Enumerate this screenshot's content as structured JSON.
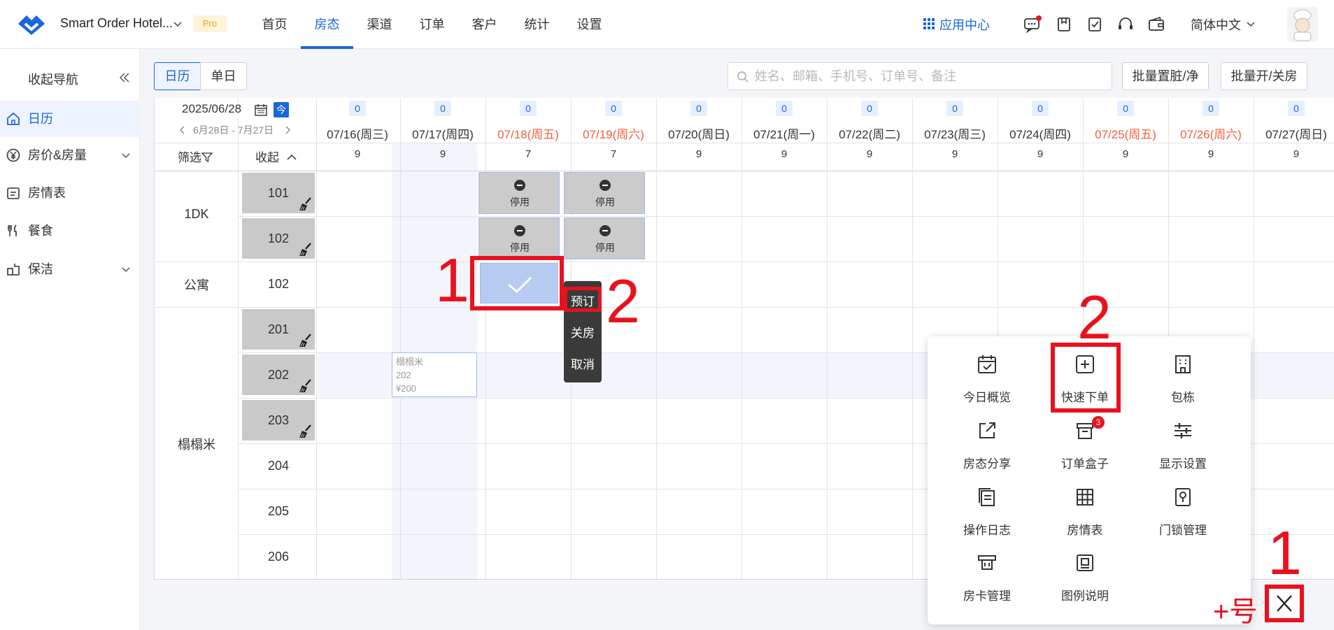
{
  "header": {
    "brand": "Smart Order Hotel...",
    "pro_badge": "Pro",
    "nav": [
      "首页",
      "房态",
      "渠道",
      "订单",
      "客户",
      "统计",
      "设置"
    ],
    "active_nav": "房态",
    "app_center": "应用中心",
    "language": "简体中文",
    "accent_color": "#1a66d9"
  },
  "sidebar": {
    "title": "收起导航",
    "items": [
      {
        "label": "日历",
        "icon": "home-icon",
        "active": true
      },
      {
        "label": "房价&房量",
        "icon": "yen-icon",
        "expandable": true
      },
      {
        "label": "房情表",
        "icon": "clipboard-icon"
      },
      {
        "label": "餐食",
        "icon": "fork-knife-icon"
      },
      {
        "label": "保洁",
        "icon": "cleaning-icon",
        "expandable": true
      }
    ]
  },
  "toolbar": {
    "view_calendar": "日历",
    "view_single": "单日",
    "search_placeholder": "姓名、邮箱、手机号、订单号、备注",
    "btn_dirty_clean": "批量置脏/净",
    "btn_open_close": "批量开/关房"
  },
  "calendar": {
    "current_date": "2025/06/28",
    "today_label": "今",
    "range": "6月28日 - 7月27日",
    "filter_label": "筛选",
    "fold_label": "收起",
    "dates": [
      {
        "label": "07/16(周三)",
        "count": "0",
        "avail": "9",
        "weekend": false
      },
      {
        "label": "07/17(周四)",
        "count": "0",
        "avail": "9",
        "weekend": false
      },
      {
        "label": "07/18(周五)",
        "count": "0",
        "avail": "7",
        "weekend": true
      },
      {
        "label": "07/19(周六)",
        "count": "0",
        "avail": "7",
        "weekend": true
      },
      {
        "label": "07/20(周日)",
        "count": "0",
        "avail": "9",
        "weekend": false
      },
      {
        "label": "07/21(周一)",
        "count": "0",
        "avail": "9",
        "weekend": false
      },
      {
        "label": "07/22(周二)",
        "count": "0",
        "avail": "9",
        "weekend": false
      },
      {
        "label": "07/23(周三)",
        "count": "0",
        "avail": "9",
        "weekend": false
      },
      {
        "label": "07/24(周四)",
        "count": "0",
        "avail": "9",
        "weekend": false
      },
      {
        "label": "07/25(周五)",
        "count": "0",
        "avail": "9",
        "weekend": true
      },
      {
        "label": "07/26(周六)",
        "count": "0",
        "avail": "9",
        "weekend": true
      },
      {
        "label": "07/27(周日)",
        "count": "0",
        "avail": "9",
        "weekend": false
      }
    ],
    "room_types": [
      "1DK",
      "公寓",
      "榻榻米"
    ],
    "rooms": [
      {
        "no": "101",
        "dirty": true
      },
      {
        "no": "102",
        "dirty": true
      },
      {
        "no": "102",
        "dirty": false
      },
      {
        "no": "201",
        "dirty": true
      },
      {
        "no": "202",
        "dirty": true
      },
      {
        "no": "203",
        "dirty": true
      },
      {
        "no": "204",
        "dirty": false
      },
      {
        "no": "205",
        "dirty": false
      },
      {
        "no": "206",
        "dirty": false
      }
    ],
    "disabled_label": "停用",
    "booking": {
      "line1": "榻榻米",
      "line2": "202",
      "line3": "¥200"
    }
  },
  "context_menu": {
    "book": "预订",
    "close": "关房",
    "cancel": "取消"
  },
  "quick_panel": {
    "items": [
      {
        "label": "今日概览",
        "icon": "calendar-check-icon"
      },
      {
        "label": "快速下单",
        "icon": "plus-square-icon"
      },
      {
        "label": "包栋",
        "icon": "building-icon"
      },
      {
        "label": "房态分享",
        "icon": "share-icon"
      },
      {
        "label": "订单盒子",
        "icon": "inbox-icon",
        "badge": "3"
      },
      {
        "label": "显示设置",
        "icon": "sliders-icon"
      },
      {
        "label": "操作日志",
        "icon": "document-icon"
      },
      {
        "label": "房情表",
        "icon": "grid-icon"
      },
      {
        "label": "门锁管理",
        "icon": "lock-icon"
      },
      {
        "label": "房卡管理",
        "icon": "card-icon"
      },
      {
        "label": "图例说明",
        "icon": "legend-icon"
      }
    ]
  },
  "annotations": {
    "one": "1",
    "two": "2",
    "plus_label": "+号"
  }
}
